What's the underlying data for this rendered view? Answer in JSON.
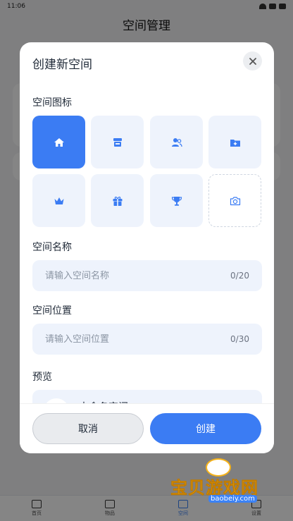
{
  "status_bar": {
    "time": "11:06"
  },
  "page": {
    "title": "空间管理"
  },
  "tabbar": {
    "items": [
      {
        "label": "首页",
        "icon": "home-icon",
        "active": false
      },
      {
        "label": "物品",
        "icon": "box-icon",
        "active": false
      },
      {
        "label": "空间",
        "icon": "space-icon",
        "active": true
      },
      {
        "label": "设置",
        "icon": "sliders-icon",
        "active": false
      }
    ]
  },
  "modal": {
    "title": "创建新空间",
    "icon_section_label": "空间图标",
    "icons": [
      {
        "name": "home-icon",
        "selected": true
      },
      {
        "name": "store-icon",
        "selected": false
      },
      {
        "name": "people-icon",
        "selected": false
      },
      {
        "name": "folder-plus-icon",
        "selected": false
      },
      {
        "name": "crown-icon",
        "selected": false
      },
      {
        "name": "gift-icon",
        "selected": false
      },
      {
        "name": "trophy-icon",
        "selected": false
      },
      {
        "name": "camera-icon",
        "selected": false
      }
    ],
    "name_label": "空间名称",
    "name_placeholder": "请输入空间名称",
    "name_value": "",
    "name_counter": "0/20",
    "location_label": "空间位置",
    "location_placeholder": "请输入空间位置",
    "location_value": "",
    "location_counter": "0/30",
    "preview_label": "预览",
    "preview_name": "未命名空间",
    "cancel_label": "取消",
    "create_label": "创建"
  },
  "watermark": {
    "title": "宝贝游戏网",
    "url": "baobeiy.com"
  },
  "colors": {
    "accent": "#3b7cf3",
    "tile_bg": "#eef3fc",
    "overlay": "rgba(0,0,0,0.48)"
  }
}
